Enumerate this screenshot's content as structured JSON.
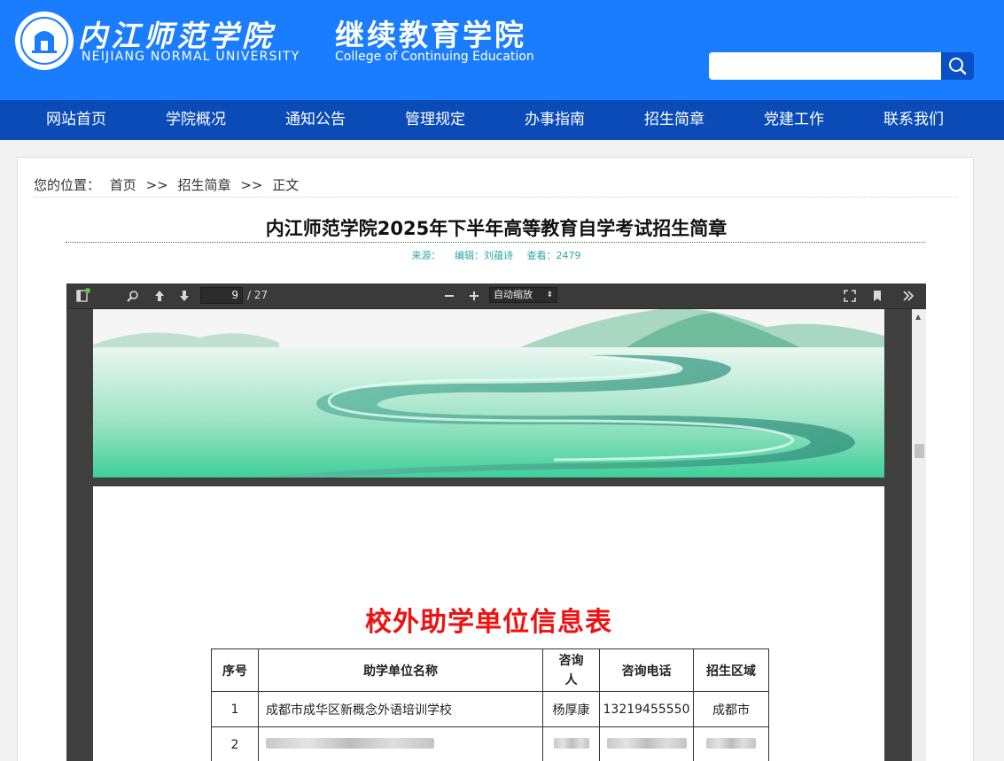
{
  "header": {
    "school_name_cn": "内江师范学院",
    "school_name_en": "NEIJIANG  NORMAL  UNIVERSITY",
    "college_name_cn": "继续教育学院",
    "college_name_en": "College of Continuing Education",
    "search_placeholder": ""
  },
  "nav": {
    "items": [
      "网站首页",
      "学院概况",
      "通知公告",
      "管理规定",
      "办事指南",
      "招生简章",
      "党建工作",
      "联系我们"
    ]
  },
  "breadcrumb": {
    "label": "您的位置：",
    "home": "首页",
    "sep": ">>",
    "section": "招生简章",
    "current": "正文"
  },
  "article": {
    "title": "内江师范学院2025年下半年高等教育自学考试招生简章",
    "source_label": "来源：",
    "editor": "编辑：刘蕴诗",
    "views": "查看：2479"
  },
  "pdf_viewer": {
    "page_number": "9",
    "page_count": "/ 27",
    "zoom": "自动缩放",
    "colors": {
      "toolbar": "#3a3a3a",
      "accent_dot": "#5ec24a"
    }
  },
  "document": {
    "title": "校外助学单位信息表",
    "table": {
      "headers": [
        "序号",
        "助学单位名称",
        "咨询人",
        "咨询电话",
        "招生区域"
      ],
      "rows": [
        [
          "1",
          "成都市成华区新概念外语培训学校",
          "杨厚康",
          "13219455550",
          "成都市"
        ],
        [
          "2",
          "",
          "",
          "",
          ""
        ]
      ]
    }
  },
  "colors": {
    "header_blue": "#1a7dff",
    "nav_blue": "#0b4bb7",
    "doc_title_red": "#ee1111",
    "meta_teal": "#2aa9a0"
  }
}
